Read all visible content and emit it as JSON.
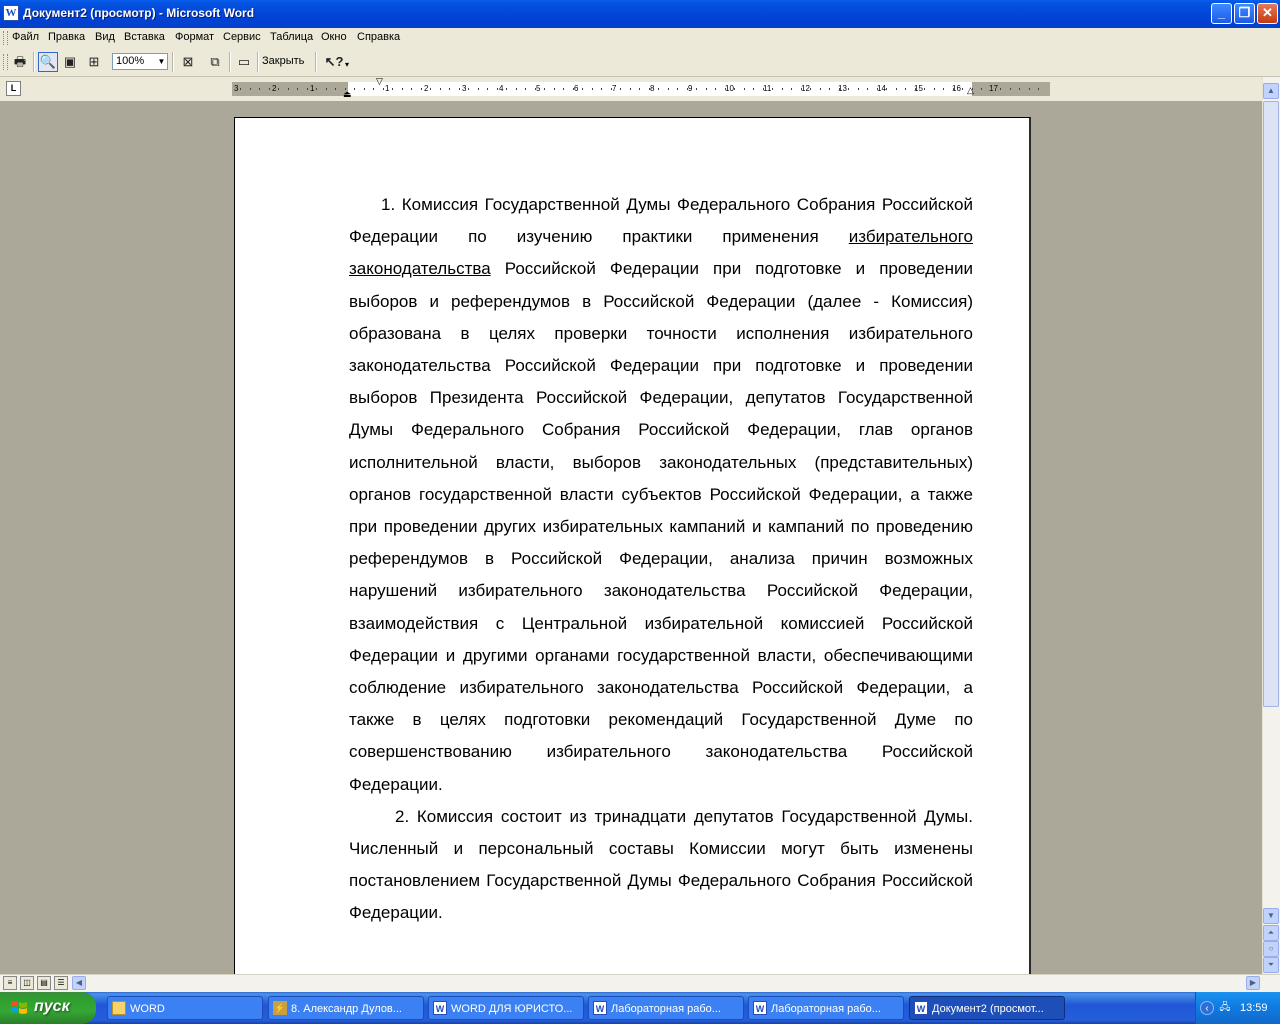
{
  "window": {
    "title": "Документ2 (просмотр) - Microsoft Word",
    "app_icon": "W"
  },
  "menu": [
    "Файл",
    "Правка",
    "Вид",
    "Вставка",
    "Формат",
    "Сервис",
    "Таблица",
    "Окно",
    "Справка"
  ],
  "toolbar": {
    "zoom": "100%",
    "close_label": "Закрыть"
  },
  "ruler": {
    "numbers": [
      "3",
      "2",
      "1",
      "1",
      "2",
      "3",
      "4",
      "5",
      "6",
      "7",
      "8",
      "9",
      "10",
      "11",
      "12",
      "13",
      "14",
      "15",
      "16",
      "17"
    ]
  },
  "document": {
    "p1_lead": "1. Комиссия Государственной Думы Федерального Собрания Российской Федерации по изучению практики применения ",
    "p1_underline": "избирательного законодательства",
    "p1_rest": " Российской Федерации при подготовке и проведении выборов и референдумов в Российской Федерации (далее - Комиссия) образована в целях проверки точности исполнения избирательного законодательства Российской Федерации при подготовке и проведении выборов Президента Российской Федерации, депутатов Государственной Думы Федерального Собрания Российской Федерации, глав органов исполнительной власти, выборов законодательных (представительных) органов государственной власти субъектов Российской Федерации, а также при проведении других избирательных кампаний и кампаний по проведению референдумов в Российской Федерации, анализа причин возможных нарушений избирательного законодательства Российской Федерации, взаимодействия с Центральной избирательной комиссией Российской Федерации и другими органами государственной власти, обеспечивающими соблюдение избирательного законодательства Российской Федерации, а также в целях подготовки рекомендаций Государственной Думе по совершенствованию избирательного законодательства Российской Федерации.",
    "p2": "2. Комиссия состоит из тринадцати депутатов Государственной Думы. Численный и персональный составы Комиссии могут быть изменены постановлением Государственной Думы Федерального Собрания Российской Федерации."
  },
  "taskbar": {
    "start_label": "пуск",
    "tasks": [
      {
        "label": "WORD",
        "icon": "folder-icon"
      },
      {
        "label": "8. Александр Дулов...",
        "icon": "winamp-icon"
      },
      {
        "label": "WORD ДЛЯ ЮРИСТО...",
        "icon": "word-icon"
      },
      {
        "label": "Лабораторная рабо...",
        "icon": "word-icon"
      },
      {
        "label": "Лабораторная рабо...",
        "icon": "word-icon"
      },
      {
        "label": "Документ2 (просмот...",
        "icon": "word-icon",
        "active": true
      }
    ],
    "clock": "13:59"
  },
  "colors": {
    "titlebar": "#0245d8",
    "workspace": "#aca899",
    "taskbar": "#245edb",
    "start": "#35a735"
  }
}
